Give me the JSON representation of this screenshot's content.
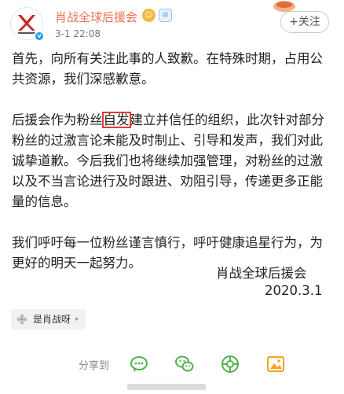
{
  "header": {
    "account_name": "肖战全球后援会",
    "timestamp": "3-1 22:08",
    "follow_label": "+关注",
    "brand_color": "#eb7350"
  },
  "post": {
    "paragraphs": [
      "首先，向所有关注此事的人致歉。在特殊时期，占用公共资源，我们深感歉意。",
      "后援会作为粉丝自发建立并信任的组织，此次针对部分粉丝的过激言论未能及时制止、引导和发声，我们对此诚挚道歉。今后我们也将继续加强管理，对粉丝的过激以及不当言论进行及时跟进、劝阻引导，传递更多正能量的信息。",
      "我们呼吁每一位粉丝谨言慎行，呼吁健康追星行为，为更好的明天一起努力。"
    ],
    "para2_before": "后援会作为粉丝",
    "para2_highlight": "自发",
    "para2_after": "建立并信任的组织，此次针对部分粉丝的过激言论未能及时制止、引导和发声，我们对此诚挚道歉。今后我们也将继续加强管理，对粉丝的过激以及不当言论进行及时跟进、劝阻引导，传递更多正能量的信息。",
    "signature_name": "肖战全球后援会",
    "signature_date": "2020.3.1",
    "highlight_color": "#e53935"
  },
  "topic": {
    "label": "是肖战呀"
  },
  "share": {
    "label": "分享到",
    "icons": [
      "chat-bubble-icon",
      "wechat-icon",
      "moments-icon",
      "photo-icon"
    ]
  }
}
